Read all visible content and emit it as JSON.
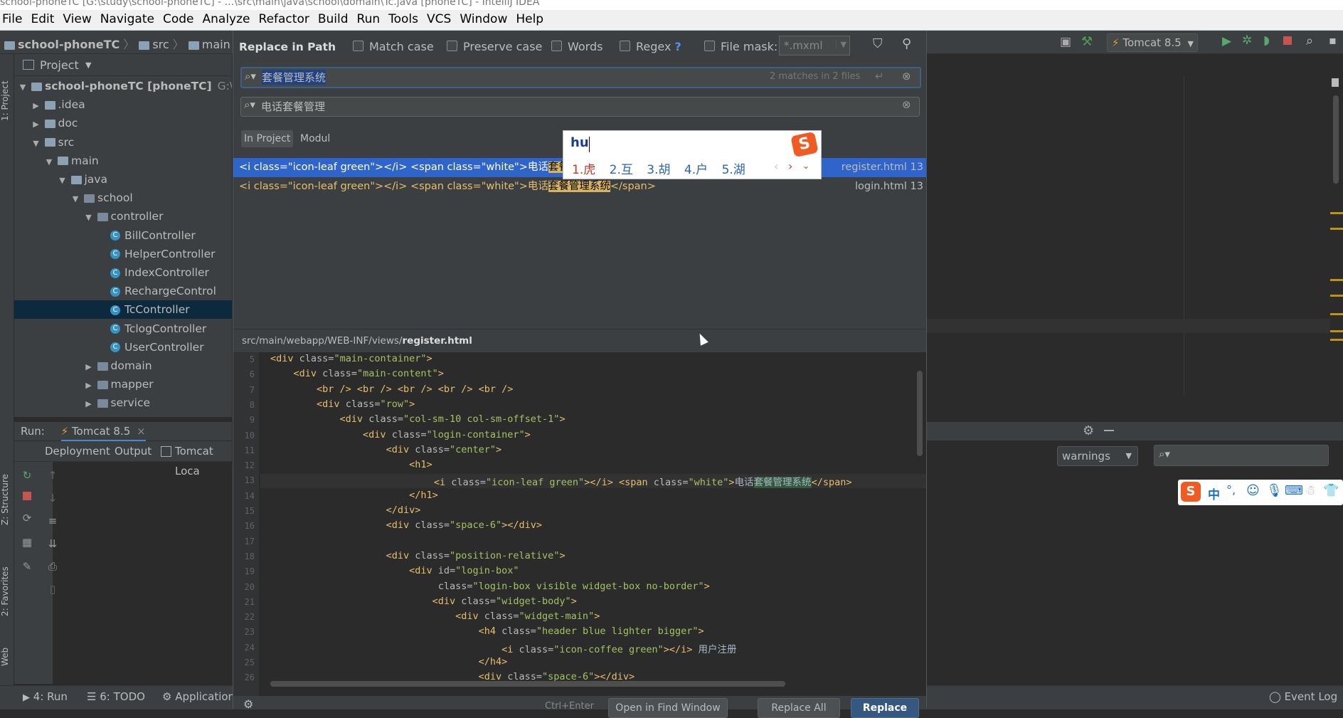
{
  "window": {
    "title": "school-phoneTC [G:\\study\\school-phoneTC] - ...\\src\\main\\java\\school\\domain\\Tc.java [phoneTC] - IntelliJ IDEA"
  },
  "menu": [
    "File",
    "Edit",
    "View",
    "Navigate",
    "Code",
    "Analyze",
    "Refactor",
    "Build",
    "Run",
    "Tools",
    "VCS",
    "Window",
    "Help"
  ],
  "breadcrumb": [
    "school-phoneTC",
    "src",
    "main"
  ],
  "project": {
    "header": "Project",
    "tree": [
      {
        "label": "school-phoneTC [phoneTC]",
        "extra": "G:\\stud",
        "level": 0,
        "kind": "module",
        "open": true
      },
      {
        "label": ".idea",
        "level": 1,
        "kind": "folder",
        "open": false
      },
      {
        "label": "doc",
        "level": 1,
        "kind": "folder",
        "open": false
      },
      {
        "label": "src",
        "level": 1,
        "kind": "folder",
        "open": true
      },
      {
        "label": "main",
        "level": 2,
        "kind": "folder",
        "open": true
      },
      {
        "label": "java",
        "level": 3,
        "kind": "folder",
        "open": true
      },
      {
        "label": "school",
        "level": 4,
        "kind": "package",
        "open": true
      },
      {
        "label": "controller",
        "level": 5,
        "kind": "package",
        "open": true
      },
      {
        "label": "BillController",
        "level": 6,
        "kind": "class"
      },
      {
        "label": "HelperController",
        "level": 6,
        "kind": "class"
      },
      {
        "label": "IndexController",
        "level": 6,
        "kind": "class"
      },
      {
        "label": "RechargeControl",
        "level": 6,
        "kind": "class"
      },
      {
        "label": "TcController",
        "level": 6,
        "kind": "class",
        "selected": true
      },
      {
        "label": "TclogController",
        "level": 6,
        "kind": "class"
      },
      {
        "label": "UserController",
        "level": 6,
        "kind": "class"
      },
      {
        "label": "domain",
        "level": 5,
        "kind": "package",
        "open": false
      },
      {
        "label": "mapper",
        "level": 5,
        "kind": "package",
        "open": false
      },
      {
        "label": "service",
        "level": 5,
        "kind": "package",
        "open": false
      }
    ]
  },
  "run": {
    "label": "Run:",
    "config": "Tomcat 8.5",
    "tabs": [
      "Deployment",
      "Output",
      "Tomcat Loca"
    ]
  },
  "side_labels": [
    "1: Project",
    "Z: Structure",
    "2: Favorites",
    "Web"
  ],
  "bottom_tabs": [
    "4: Run",
    "6: TODO",
    "Application"
  ],
  "event_log": "Event Log",
  "toolbar": {
    "run_config": "Tomcat 8.5"
  },
  "right_panel": {
    "filter": "warnings"
  },
  "ime_bar": {
    "items": [
      "中",
      "°,"
    ]
  },
  "dialog": {
    "title": "Replace in Path",
    "options": [
      "Match case",
      "Preserve case",
      "Words",
      "Regex",
      "File mask:"
    ],
    "regex_help": "?",
    "file_mask_value": "*.mxml",
    "search_value": "套餐管理系统",
    "search_status": "2 matches in 2 files",
    "replace_value": "电话套餐管理",
    "scopes": [
      "In Project",
      "Modul"
    ],
    "ime": {
      "input": "hu",
      "candidates": [
        "1.虎",
        "2.互",
        "3.胡",
        "4.户",
        "5.湖"
      ]
    },
    "results": [
      {
        "pre": "<i class=\"icon-leaf green\"></i> <span class=\"white\">电话",
        "match": "套餐管理系统",
        "post": "</span>",
        "file": "register.html 13",
        "selected": true
      },
      {
        "pre": "<i class=\"icon-leaf green\"></i> <span class=\"white\">电话",
        "match": "套餐管理系统",
        "post": "</span>",
        "file": "login.html 13",
        "selected": false
      }
    ],
    "preview_path_dir": "src/main/webapp/WEB-INF/views/",
    "preview_path_file": "register.html",
    "shortcut": "Ctrl+Enter",
    "buttons": {
      "open_find": "Open in Find Window",
      "replace_all": "Replace All",
      "replace": "Replace"
    }
  },
  "code_lines": [
    {
      "n": "5",
      "indent": 0,
      "tag": "<div",
      "attrs": [
        [
          "class",
          "\"main-container\""
        ]
      ],
      "end": ">"
    },
    {
      "n": "6",
      "indent": 1,
      "tag": "<div",
      "attrs": [
        [
          "class",
          "\"main-content\""
        ]
      ],
      "end": ">"
    },
    {
      "n": "7",
      "indent": 2,
      "raw": "<br /> <br /> <br /> <br /> <br />"
    },
    {
      "n": "8",
      "indent": 2,
      "tag": "<div",
      "attrs": [
        [
          "class",
          "\"row\""
        ]
      ],
      "end": ">"
    },
    {
      "n": "9",
      "indent": 3,
      "tag": "<div",
      "attrs": [
        [
          "class",
          "\"col-sm-10 col-sm-offset-1\""
        ]
      ],
      "end": ">"
    },
    {
      "n": "10",
      "indent": 4,
      "tag": "<div",
      "attrs": [
        [
          "class",
          "\"login-container\""
        ]
      ],
      "end": ">"
    },
    {
      "n": "11",
      "indent": 5,
      "tag": "<div",
      "attrs": [
        [
          "class",
          "\"center\""
        ]
      ],
      "end": ">"
    },
    {
      "n": "12",
      "indent": 6,
      "raw": "<h1>"
    },
    {
      "n": "13",
      "indent": 7,
      "special": true
    },
    {
      "n": "14",
      "indent": 6,
      "raw": "</h1>"
    },
    {
      "n": "15",
      "indent": 5,
      "raw": "</div>"
    },
    {
      "n": "16",
      "indent": 5,
      "tag": "<div",
      "attrs": [
        [
          "class",
          "\"space-6\""
        ]
      ],
      "end": "></div>"
    },
    {
      "n": "17",
      "indent": 0,
      "raw": ""
    },
    {
      "n": "18",
      "indent": 5,
      "tag": "<div",
      "attrs": [
        [
          "class",
          "\"position-relative\""
        ]
      ],
      "end": ">"
    },
    {
      "n": "19",
      "indent": 6,
      "tag": "<div",
      "attrs": [
        [
          "id",
          "\"login-box\""
        ]
      ],
      "end": ""
    },
    {
      "n": "20",
      "indent": 7,
      "tag": "",
      "attrs": [
        [
          "class",
          "\"login-box visible widget-box no-border\""
        ]
      ],
      "end": ">"
    },
    {
      "n": "21",
      "indent": 7,
      "tag": "<div",
      "attrs": [
        [
          "class",
          "\"widget-body\""
        ]
      ],
      "end": ">"
    },
    {
      "n": "22",
      "indent": 8,
      "tag": "<div",
      "attrs": [
        [
          "class",
          "\"widget-main\""
        ]
      ],
      "end": ">"
    },
    {
      "n": "23",
      "indent": 9,
      "tag": "<h4",
      "attrs": [
        [
          "class",
          "\"header blue lighter bigger\""
        ]
      ],
      "end": ">"
    },
    {
      "n": "24",
      "indent": 10,
      "tag": "<i",
      "attrs": [
        [
          "class",
          "\"icon-coffee green\""
        ]
      ],
      "end": "></i>",
      "text": " 用户注册"
    },
    {
      "n": "25",
      "indent": 9,
      "raw": "</h4>"
    },
    {
      "n": "26",
      "indent": 9,
      "tag": "<div",
      "attrs": [
        [
          "class",
          "\"space-6\""
        ]
      ],
      "end": "></div>"
    }
  ],
  "line13": {
    "pre": "<i ",
    "a1": "class=",
    "v1": "\"icon-leaf green\"",
    "mid": "></i> <span ",
    "a2": "class=",
    "v2": "\"white\"",
    "gt": ">",
    "txt": "电话",
    "match": "套餐管理系统",
    "post": "</span>"
  },
  "colors": {
    "accent": "#2f65ca",
    "match": "#d7b45f",
    "editor_bg": "#2b2b2b",
    "panel_bg": "#3c3f41"
  }
}
